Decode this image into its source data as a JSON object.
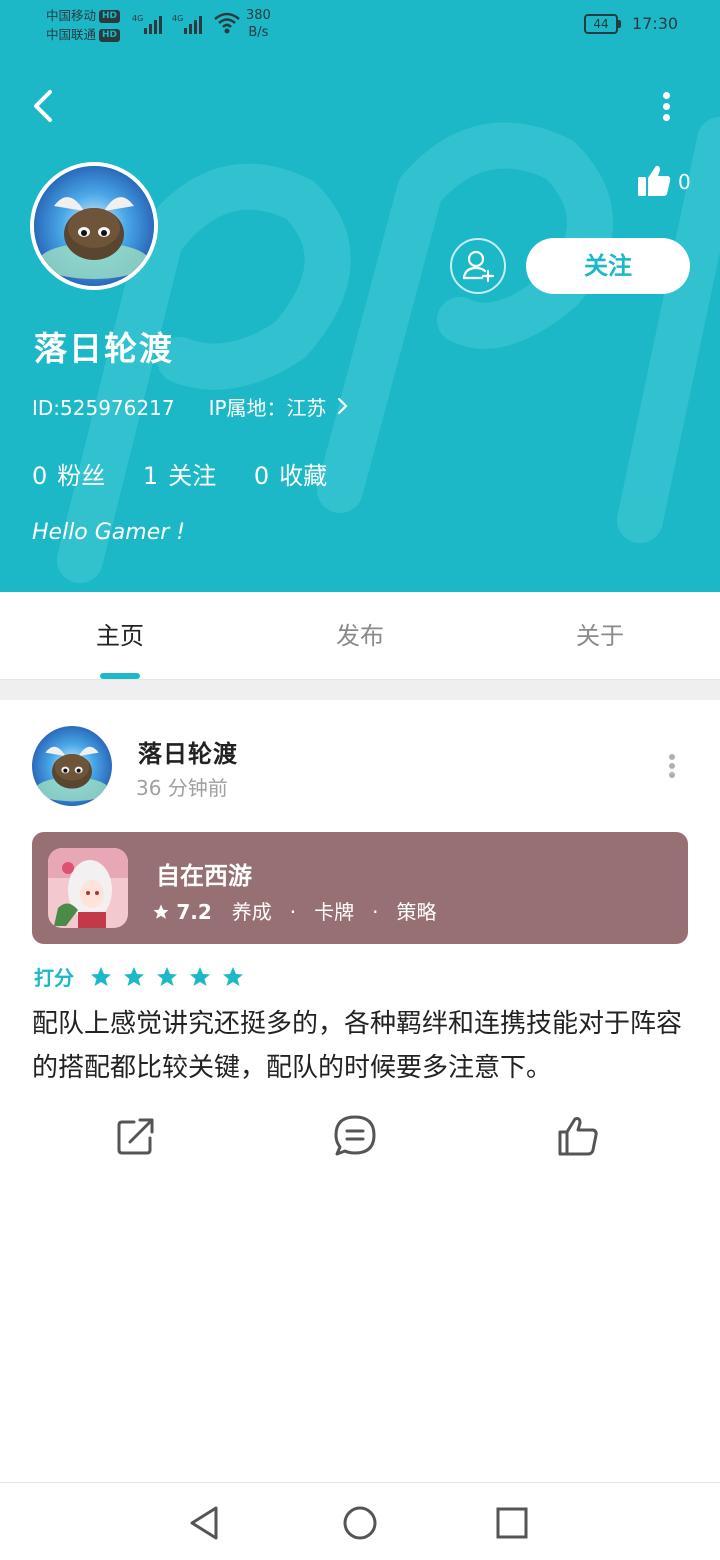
{
  "status_bar": {
    "carrier_1": "中国移动",
    "carrier_2": "中国联通",
    "hd_badge": "HD",
    "network_type": "4G",
    "speed_value": "380",
    "speed_unit": "B/s",
    "battery": "44",
    "time": "17:30"
  },
  "header": {
    "background_color": "#1cb8c7",
    "like_count": "0",
    "follow_label": "关注",
    "username": "落日轮渡",
    "user_id": "ID:525976217",
    "ip_location": "IP属地：江苏",
    "stats": [
      {
        "value": "0",
        "label": "粉丝"
      },
      {
        "value": "1",
        "label": "关注"
      },
      {
        "value": "0",
        "label": "收藏"
      }
    ],
    "bio": "Hello Gamer !"
  },
  "tabs": [
    {
      "label": "主页",
      "active": true
    },
    {
      "label": "发布",
      "active": false
    },
    {
      "label": "关于",
      "active": false
    }
  ],
  "post": {
    "author": "落日轮渡",
    "time_ago": "36 分钟前",
    "game": {
      "name": "自在西游",
      "rating": "7.2",
      "tags": [
        "养成",
        "卡牌",
        "策略"
      ],
      "card_color": "#967073"
    },
    "score_label": "打分",
    "stars": 5,
    "content": "配队上感觉讲究还挺多的，各种羁绊和连携技能对于阵容的搭配都比较关键，配队的时候要多注意下。",
    "actions": [
      "share-icon",
      "comment-icon",
      "like-icon"
    ]
  },
  "nav_bar": [
    "back-triangle-icon",
    "home-circle-icon",
    "recents-square-icon"
  ]
}
